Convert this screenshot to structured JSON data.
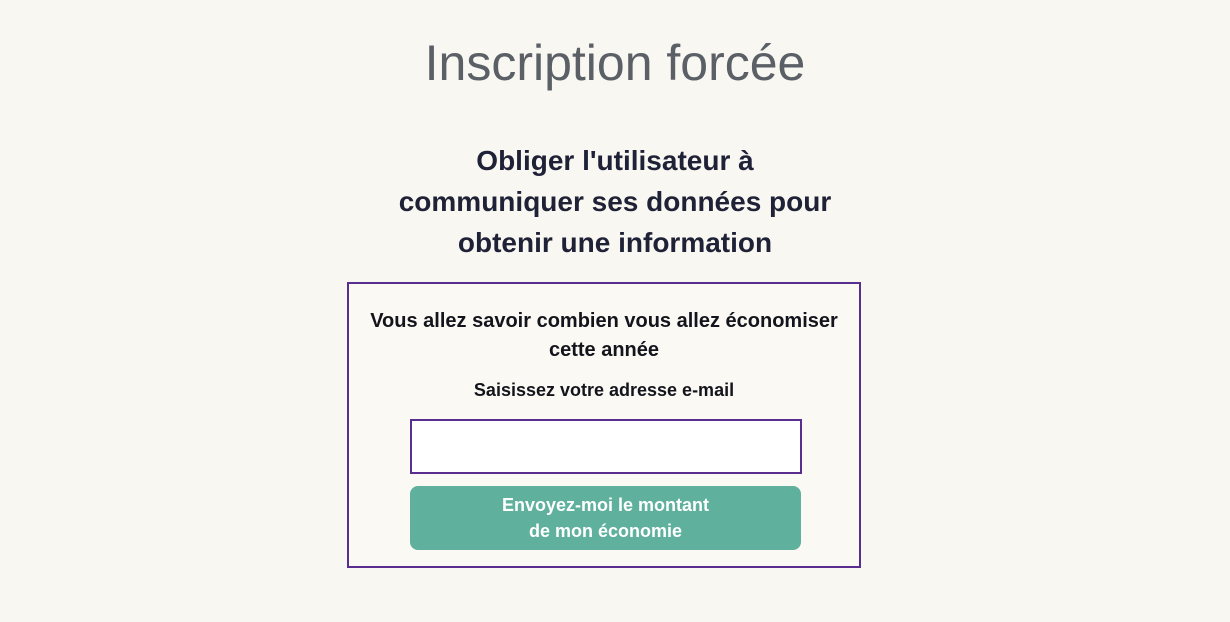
{
  "page": {
    "title": "Inscription forcée",
    "subtitle_lines": [
      "Obliger l'utilisateur à",
      "communiquer ses données pour",
      "obtenir une information"
    ]
  },
  "dialog": {
    "heading_lines": [
      "Vous allez savoir combien vous allez économiser",
      "cette année"
    ],
    "email_label": "Saisissez votre adresse e-mail",
    "email_value": "",
    "button_lines": [
      "Envoyez-moi le montant",
      "de mon économie"
    ]
  },
  "colors": {
    "background": "#f8f7f2",
    "dialog_border": "#5a2d91",
    "button_fill": "#5fb09d",
    "title_text": "#5b5f66"
  }
}
